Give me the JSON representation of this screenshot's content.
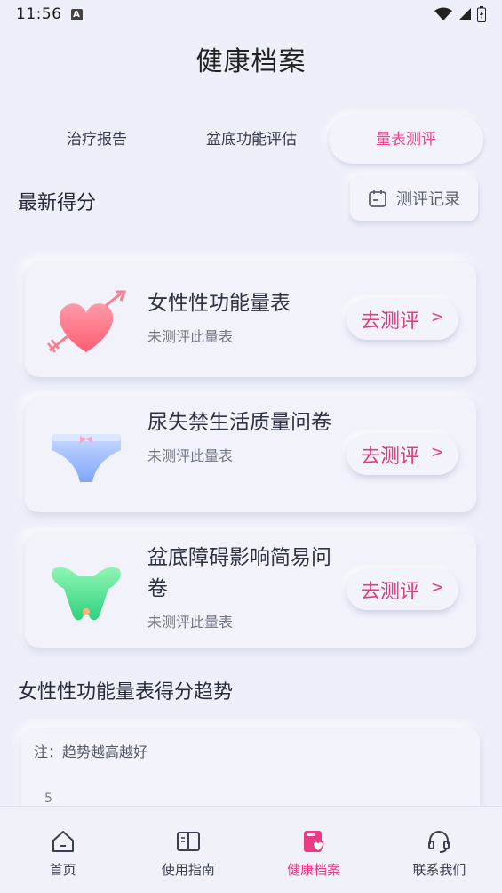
{
  "status_bar": {
    "time": "11:56"
  },
  "header": {
    "title": "健康档案"
  },
  "tabs": [
    {
      "label": "治疗报告"
    },
    {
      "label": "盆底功能评估"
    },
    {
      "label": "量表测评"
    }
  ],
  "latest": {
    "title": "最新得分",
    "record_button": "测评记录"
  },
  "scales": [
    {
      "name": "女性性功能量表",
      "status": "未测评此量表",
      "action": "去测评"
    },
    {
      "name": "尿失禁生活质量问卷",
      "status": "未测评此量表",
      "action": "去测评"
    },
    {
      "name": "盆底障碍影响简易问卷",
      "status": "未测评此量表",
      "action": "去测评"
    }
  ],
  "trend": {
    "title": "女性性功能量表得分趋势",
    "note": "注：趋势越高越好",
    "first_tick": "5"
  },
  "bottom_nav": [
    {
      "label": "首页"
    },
    {
      "label": "使用指南"
    },
    {
      "label": "健康档案"
    },
    {
      "label": "联系我们"
    }
  ],
  "colors": {
    "accent": "#ea3c85",
    "background": "#eef0f9"
  }
}
